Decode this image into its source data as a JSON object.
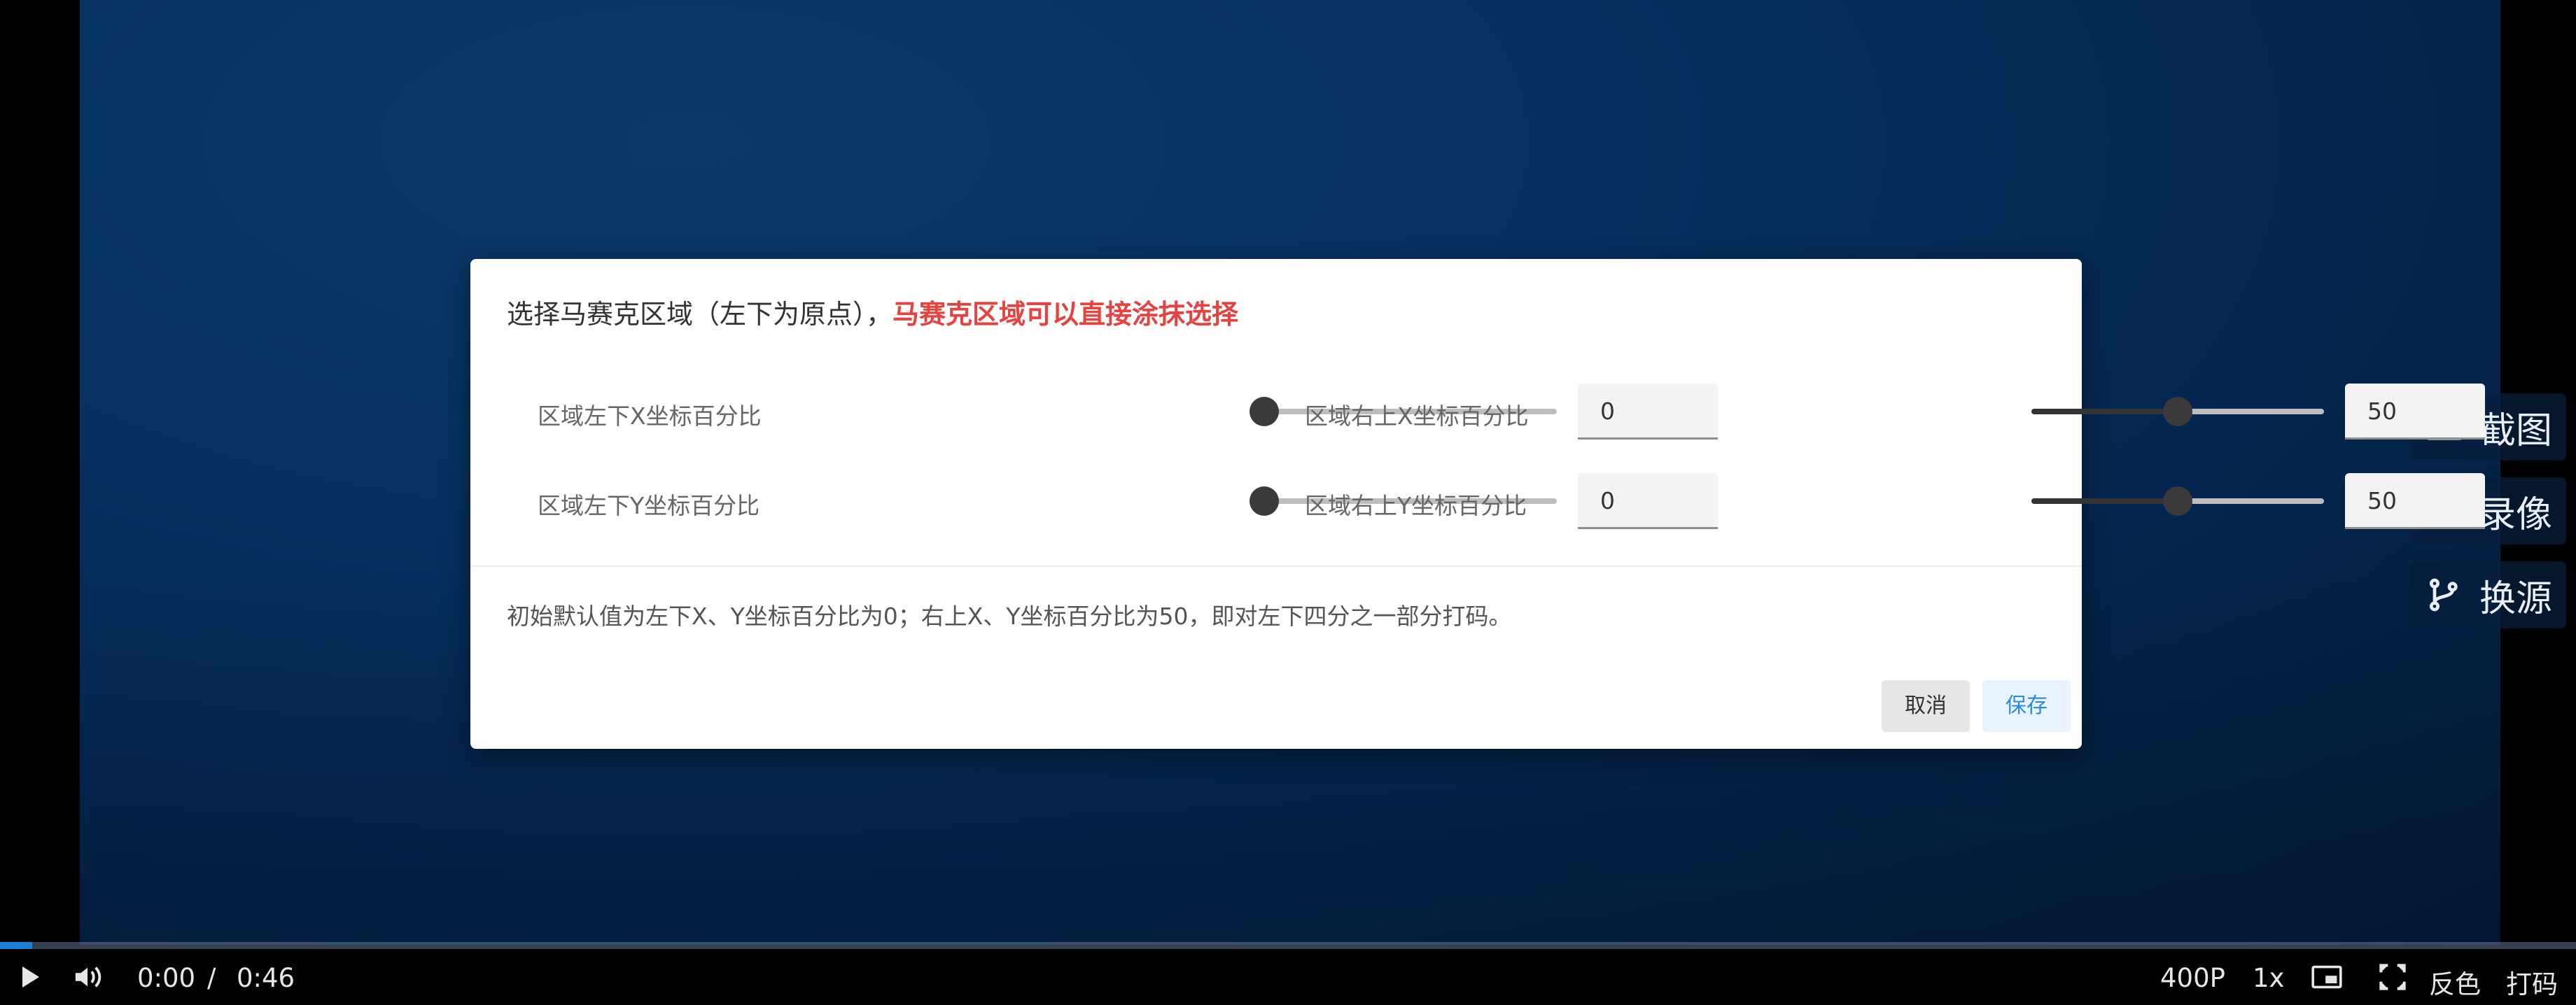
{
  "dialog": {
    "title": "选择马赛克区域（左下为原点），",
    "title_highlight": "马赛克区域可以直接涂抹选择",
    "fields": {
      "bottom_left_x": {
        "label": "区域左下X坐标百分比",
        "value": "0",
        "percent": 0
      },
      "top_right_x": {
        "label": "区域右上X坐标百分比",
        "value": "50",
        "percent": 50
      },
      "bottom_left_y": {
        "label": "区域左下Y坐标百分比",
        "value": "0",
        "percent": 0
      },
      "top_right_y": {
        "label": "区域右上Y坐标百分比",
        "value": "50",
        "percent": 50
      }
    },
    "note": "初始默认值为左下X、Y坐标百分比为0；右上X、Y坐标百分比为50，即对左下四分之一部分打码。",
    "cancel_label": "取消",
    "save_label": "保存"
  },
  "side_panel": {
    "screenshot_label": "截图",
    "record_label": "录像",
    "switch_source_label": "换源"
  },
  "player": {
    "current_time": "0:00",
    "separator": "/",
    "duration": "0:46",
    "quality": "400P",
    "speed": "1x",
    "invert_label": "反色",
    "mosaic_label": "打码",
    "progress_fraction": 0.0
  },
  "colors": {
    "highlight": "#e64340",
    "save_text": "#2a8ddb",
    "progress_played": "#1e7fd6"
  },
  "icons": {
    "screenshot": "camera-icon",
    "record": "monitor-icon",
    "switch_source": "branch-icon",
    "play": "play-icon",
    "volume": "volume-icon",
    "pip": "picture-in-picture-icon",
    "fullscreen": "fullscreen-icon"
  }
}
